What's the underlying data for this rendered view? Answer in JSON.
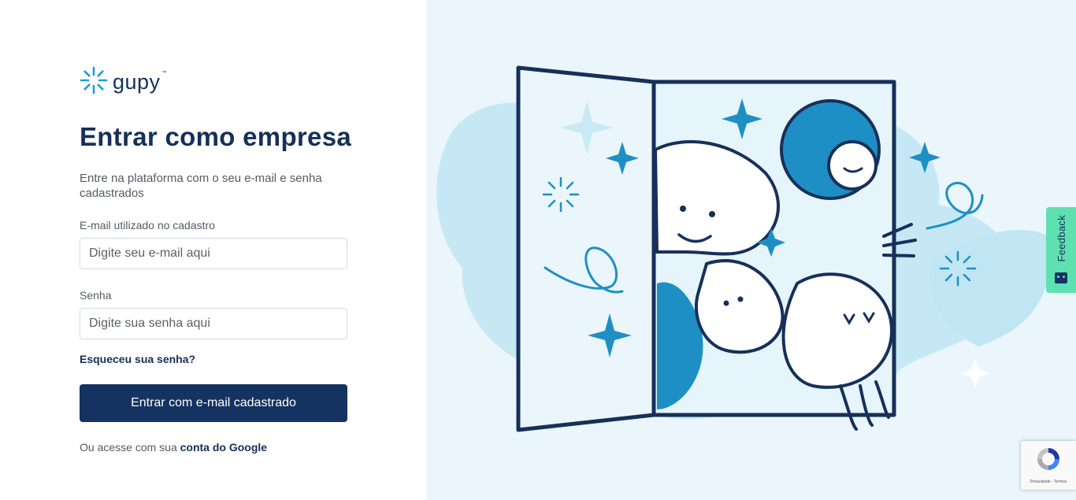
{
  "brand": {
    "name": "gupy",
    "tm": "™"
  },
  "login": {
    "title": "Entrar como empresa",
    "subtitle": "Entre na plataforma com o seu e-mail e senha cadastrados",
    "email_label": "E-mail utilizado no cadastro",
    "email_placeholder": "Digite seu e-mail aqui",
    "password_label": "Senha",
    "password_placeholder": "Digite sua senha aqui",
    "forgot_password": "Esqueceu sua senha?",
    "submit_label": "Entrar com e-mail cadastrado",
    "google_prefix": "Ou acesse com sua",
    "google_link": "conta do Google"
  },
  "feedback": {
    "label": "Feedback"
  },
  "recaptcha": {
    "privacy": "Privacidade",
    "separator": " - ",
    "terms": "Termos"
  },
  "colors": {
    "brand_navy": "#143360",
    "brand_blue": "#1e9cd7",
    "illustration_light": "#c6e8f4",
    "illustration_panel": "#eaf6fc",
    "feedback_green": "#5fe0b0"
  },
  "icons": {
    "logo": "gupy-sparkle-icon",
    "feedback": "chat-smile-icon",
    "recaptcha": "recaptcha-icon"
  }
}
